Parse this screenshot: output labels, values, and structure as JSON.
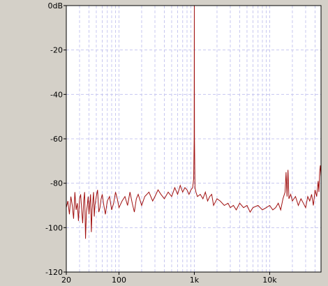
{
  "colors": {
    "background": "#d4d0c8",
    "plot_background": "#ffffff",
    "grid": "#c8c8f0",
    "trace": "#a01010",
    "frame": "#000000"
  },
  "chart_data": {
    "type": "line",
    "title": "",
    "xlabel": "",
    "ylabel": "",
    "x_scale": "log",
    "xlim": [
      20,
      48000
    ],
    "ylim": [
      -120,
      0
    ],
    "grid": true,
    "x_tick_labels": [
      {
        "value": 20,
        "label": "20"
      },
      {
        "value": 100,
        "label": "100"
      },
      {
        "value": 1000,
        "label": "1k"
      },
      {
        "value": 10000,
        "label": "10k"
      }
    ],
    "y_tick_labels": [
      {
        "value": 0,
        "label": "0dB"
      },
      {
        "value": -20,
        "label": "-20"
      },
      {
        "value": -40,
        "label": "-40"
      },
      {
        "value": -60,
        "label": "-60"
      },
      {
        "value": -80,
        "label": "-80"
      },
      {
        "value": -100,
        "label": "-100"
      },
      {
        "value": -120,
        "label": "-120"
      }
    ],
    "series": [
      {
        "x": [
          20,
          21,
          22,
          23,
          24,
          25,
          26,
          27,
          28,
          29,
          30,
          31,
          32,
          33,
          34,
          35,
          36,
          37,
          38,
          39,
          40,
          41,
          42,
          43,
          44,
          45,
          46,
          47,
          48,
          50,
          52,
          54,
          56,
          58,
          60,
          63,
          66,
          70,
          75,
          80,
          85,
          90,
          95,
          100,
          110,
          120,
          130,
          140,
          150,
          160,
          170,
          180,
          200,
          220,
          250,
          280,
          300,
          330,
          360,
          400,
          450,
          500,
          550,
          600,
          650,
          700,
          750,
          800,
          850,
          900,
          950,
          980,
          995,
          1000,
          1005,
          1020,
          1050,
          1100,
          1200,
          1300,
          1400,
          1500,
          1600,
          1700,
          1800,
          2000,
          2200,
          2500,
          2800,
          3000,
          3300,
          3600,
          4000,
          4500,
          5000,
          5500,
          6000,
          7000,
          8000,
          9000,
          10000,
          11000,
          12000,
          13000,
          14000,
          15000,
          16000,
          16500,
          17000,
          17500,
          18000,
          19000,
          20000,
          22000,
          24000,
          26000,
          28000,
          30000,
          32000,
          34000,
          36000,
          38000,
          40000,
          42000,
          44000,
          45000,
          46000,
          47000,
          48000
        ],
        "values": [
          -91,
          -88,
          -94,
          -86,
          -90,
          -96,
          -84,
          -92,
          -89,
          -97,
          -87,
          -85,
          -92,
          -98,
          -88,
          -84,
          -105,
          -93,
          -90,
          -86,
          -94,
          -89,
          -85,
          -102,
          -92,
          -88,
          -84,
          -95,
          -90,
          -86,
          -83,
          -93,
          -91,
          -87,
          -85,
          -90,
          -94,
          -88,
          -86,
          -92,
          -89,
          -84,
          -87,
          -91,
          -88,
          -86,
          -90,
          -84,
          -89,
          -93,
          -87,
          -85,
          -90,
          -86,
          -84,
          -88,
          -86,
          -83,
          -85,
          -87,
          -84,
          -86,
          -82,
          -85,
          -81,
          -84,
          -82,
          -83,
          -85,
          -83,
          -82,
          -78,
          -60,
          0,
          -60,
          -82,
          -84,
          -86,
          -85,
          -87,
          -84,
          -88,
          -86,
          -85,
          -90,
          -87,
          -88,
          -90,
          -89,
          -91,
          -90,
          -92,
          -89,
          -91,
          -90,
          -93,
          -91,
          -90,
          -92,
          -91,
          -90,
          -92,
          -91,
          -89,
          -92,
          -87,
          -84,
          -75,
          -86,
          -74,
          -87,
          -85,
          -88,
          -86,
          -90,
          -87,
          -89,
          -91,
          -86,
          -88,
          -85,
          -90,
          -83,
          -86,
          -79,
          -84,
          -75,
          -72,
          -77
        ]
      }
    ]
  }
}
